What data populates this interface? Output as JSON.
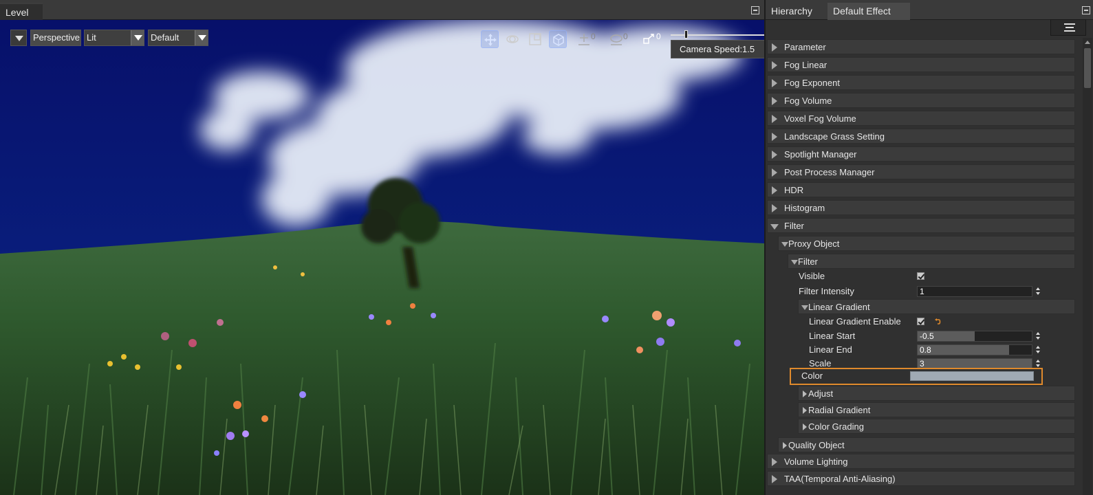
{
  "level": {
    "tab_label": "Level",
    "toolbar": {
      "view_mode": "Perspective",
      "shading_select": "Lit",
      "preset_select": "Default",
      "translate_snap": "0",
      "rotate_snap": "0",
      "scale_snap": "0",
      "camera_speed": "Camera Speed:1.5"
    }
  },
  "right": {
    "tabs": [
      "Hierarchy",
      "Default Effect"
    ],
    "sections": [
      "Parameter",
      "Fog Linear",
      "Fog Exponent",
      "Fog Volume",
      "Voxel Fog Volume",
      "Landscape Grass Setting",
      "Spotlight Manager",
      "Post Process Manager",
      "HDR",
      "Histogram"
    ],
    "filter": {
      "label": "Filter",
      "proxy_object": "Proxy Object",
      "sub_filter": "Filter",
      "visible_label": "Visible",
      "filter_intensity_label": "Filter Intensity",
      "filter_intensity_value": "1",
      "linear_gradient": "Linear Gradient",
      "linear_gradient_enable_label": "Linear Gradient Enable",
      "linear_start_label": "Linear Start",
      "linear_start_value": "-0.5",
      "linear_start_fill": 0.5,
      "linear_end_label": "Linear End",
      "linear_end_value": "0.8",
      "linear_end_fill": 0.8,
      "scale_label": "Scale",
      "scale_value": "3",
      "color_label": "Color",
      "color_value": "#a0aab4",
      "adjust": "Adjust",
      "radial_gradient": "Radial Gradient",
      "color_grading": "Color Grading",
      "quality_object": "Quality Object"
    },
    "bottom_sections": [
      "Volume Lighting",
      "TAA(Temporal Anti-Aliasing)"
    ]
  },
  "colors": {
    "panel_bg": "#303030",
    "row_bg": "#3b3b3b",
    "highlight": "#e08a2c",
    "sky": "#0a1b6e"
  }
}
